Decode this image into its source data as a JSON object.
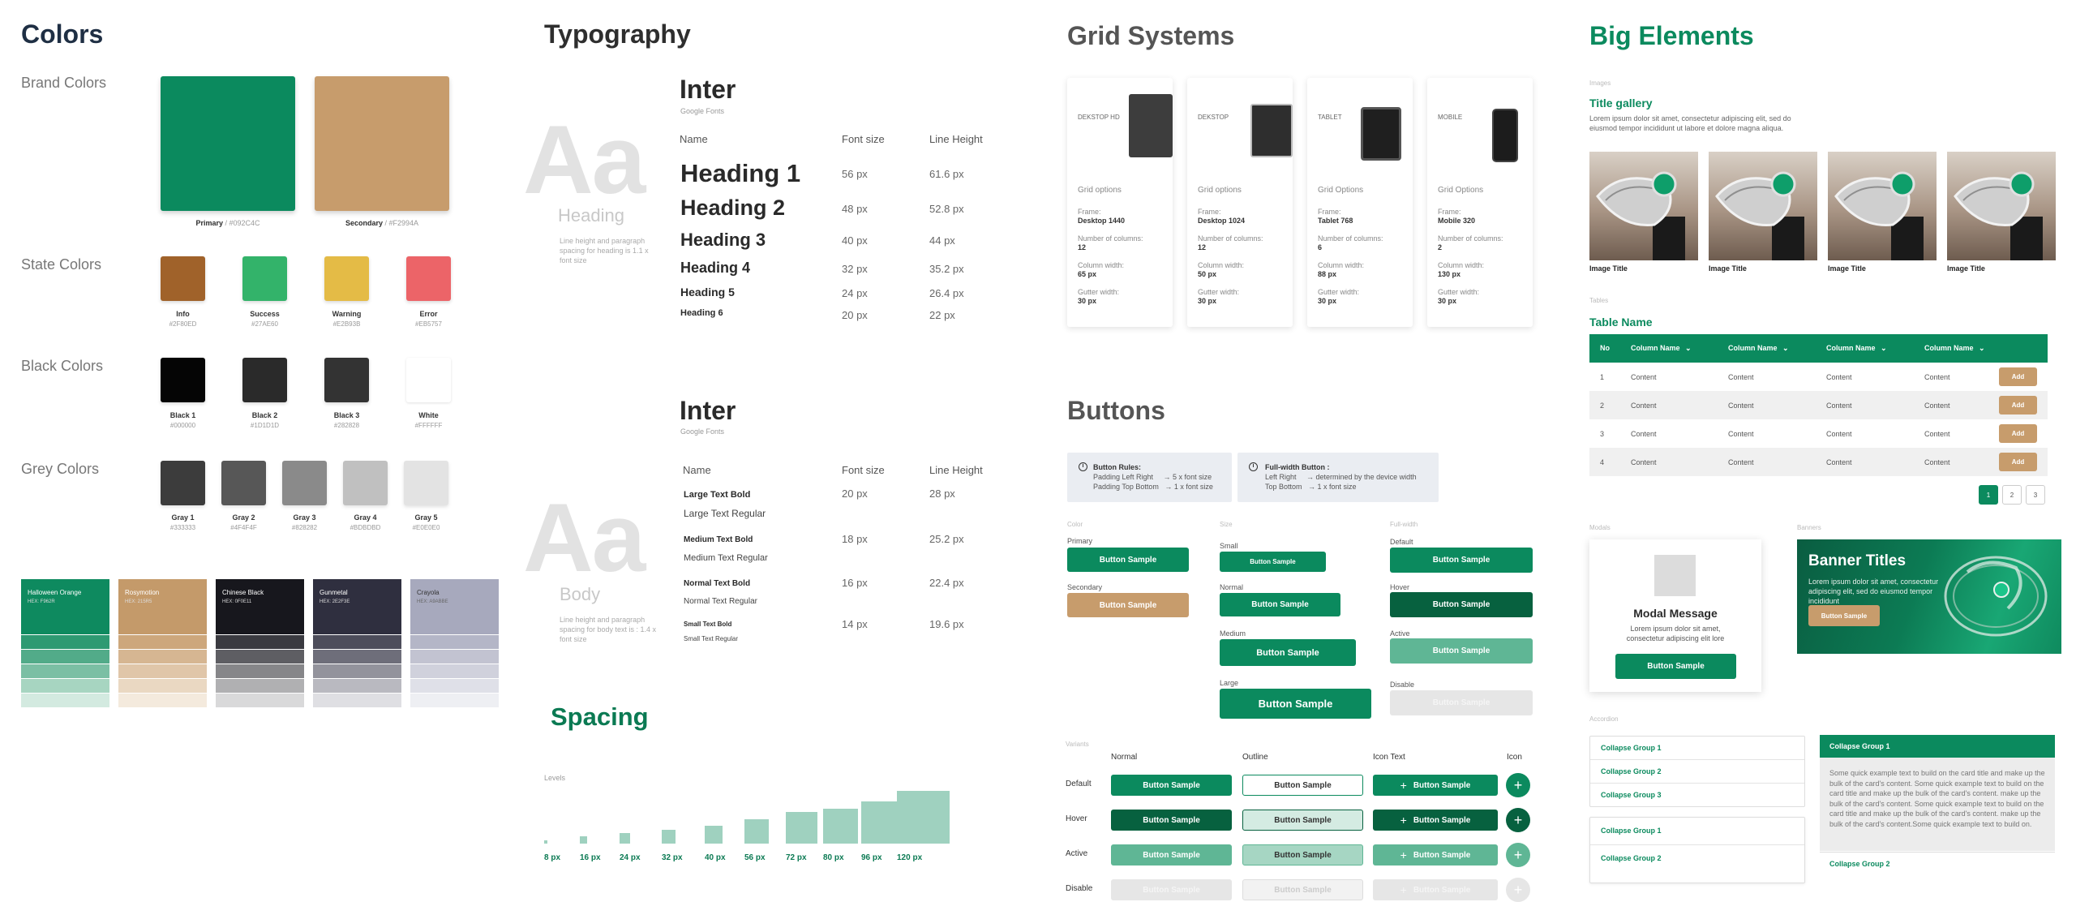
{
  "colors": {
    "title": "Colors",
    "brand_label": "Brand Colors",
    "state_label": "State Colors",
    "black_label": "Black Colors",
    "grey_label": "Grey Colors",
    "brand": [
      {
        "name": "Primary",
        "hex": "#0B8C5E",
        "caption": "#092C4C",
        "color": "#0b8a5e"
      },
      {
        "name": "Secondary",
        "hex": "#C8A06E",
        "caption": "#F2994A",
        "color": "#c79c6c"
      }
    ],
    "state": [
      {
        "name": "Info",
        "hex": "#2F80ED",
        "color": "#a0622a"
      },
      {
        "name": "Success",
        "hex": "#27AE60",
        "color": "#33b36a"
      },
      {
        "name": "Warning",
        "hex": "#E2B93B",
        "color": "#e4bb46"
      },
      {
        "name": "Error",
        "hex": "#EB5757",
        "color": "#ec6468"
      }
    ],
    "black": [
      {
        "name": "Black 1",
        "hex": "#000000",
        "color": "#050505"
      },
      {
        "name": "Black 2",
        "hex": "#1D1D1D",
        "color": "#2a2a2a"
      },
      {
        "name": "Black 3",
        "hex": "#282828",
        "color": "#333333"
      },
      {
        "name": "White",
        "hex": "#FFFFFF",
        "color": "#ffffff"
      }
    ],
    "grey": [
      {
        "name": "Gray 1",
        "hex": "#333333",
        "color": "#3c3c3c"
      },
      {
        "name": "Gray 2",
        "hex": "#4F4F4F",
        "color": "#575757"
      },
      {
        "name": "Gray 3",
        "hex": "#828282",
        "color": "#8a8a8a"
      },
      {
        "name": "Gray 4",
        "hex": "#BDBDBD",
        "color": "#c0c0c0"
      },
      {
        "name": "Gray 5",
        "hex": "#E0E0E0",
        "color": "#e3e3e3"
      }
    ],
    "palettes": [
      {
        "name": "Halloween Orange",
        "hex": "HEX: F962R",
        "base": "#0e8a5f",
        "shades": [
          "#2e9a72",
          "#52ab89",
          "#7bbfa4",
          "#a7d5c1",
          "#d3eae0"
        ]
      },
      {
        "name": "Rosymotion",
        "hex": "HEX: 215R5",
        "base": "#c49a6a",
        "shades": [
          "#cda77c",
          "#d6b692",
          "#e0c6a9",
          "#ead8c2",
          "#f4eadd"
        ]
      },
      {
        "name": "Chinese Black",
        "hex": "HEX: 0F0E11",
        "base": "#17171d",
        "shades": [
          "#3a3a40",
          "#5e5e63",
          "#868689",
          "#b0b0b2",
          "#d9d9da"
        ]
      },
      {
        "name": "Gunmetal",
        "hex": "HEX: 2E2F3E",
        "base": "#2f2f3f",
        "shades": [
          "#4d4d5b",
          "#6e6e7a",
          "#93939c",
          "#b9b9c0",
          "#dfdfe3"
        ]
      },
      {
        "name": "Crayola",
        "hex": "HEX: A9ABBE",
        "base": "#a7a9bd",
        "shades": [
          "#b4b6c7",
          "#c2c3d1",
          "#d0d1dc",
          "#dfe0e8",
          "#eeeff3"
        ]
      }
    ]
  },
  "typography": {
    "title": "Typography",
    "heading_block": {
      "font": "Inter",
      "source": "Google Fonts",
      "sample": "Aa",
      "kind": "Heading",
      "note": "Line height and paragraph spacing for heading is 1.1 x font size",
      "cols": [
        "Name",
        "Font size",
        "Line Height"
      ],
      "rows": [
        {
          "name": "Heading 1",
          "size": "56 px",
          "lh": "61.6 px"
        },
        {
          "name": "Heading 2",
          "size": "48 px",
          "lh": "52.8 px"
        },
        {
          "name": "Heading 3",
          "size": "40 px",
          "lh": "44 px"
        },
        {
          "name": "Heading 4",
          "size": "32 px",
          "lh": "35.2 px"
        },
        {
          "name": "Heading 5",
          "size": "24 px",
          "lh": "26.4 px"
        },
        {
          "name": "Heading 6",
          "size": "20 px",
          "lh": "22 px"
        }
      ]
    },
    "body_block": {
      "font": "Inter",
      "source": "Google Fonts",
      "sample": "Aa",
      "kind": "Body",
      "note": "Line height and paragraph spacing for body text is : 1.4 x font size",
      "cols": [
        "Name",
        "Font size",
        "Line Height"
      ],
      "rows": [
        {
          "bold": "Large Text Bold",
          "regular": "Large Text Regular",
          "size": "20 px",
          "lh": "28 px"
        },
        {
          "bold": "Medium Text Bold",
          "regular": "Medium Text Regular",
          "size": "18 px",
          "lh": "25.2 px"
        },
        {
          "bold": "Normal Text Bold",
          "regular": "Normal Text Regular",
          "size": "16 px",
          "lh": "22.4 px"
        },
        {
          "bold": "Small Text Bold",
          "regular": "Small Text Regular",
          "size": "14 px",
          "lh": "19.6 px"
        }
      ]
    }
  },
  "spacing": {
    "title": "Spacing",
    "levels_label": "Levels",
    "levels": [
      {
        "label": "8 px",
        "value": 8
      },
      {
        "label": "16 px",
        "value": 16
      },
      {
        "label": "24 px",
        "value": 24
      },
      {
        "label": "32 px",
        "value": 32
      },
      {
        "label": "40 px",
        "value": 40
      },
      {
        "label": "56 px",
        "value": 56
      },
      {
        "label": "72 px",
        "value": 72
      },
      {
        "label": "80 px",
        "value": 80
      },
      {
        "label": "96 px",
        "value": 96
      },
      {
        "label": "120 px",
        "value": 120
      }
    ]
  },
  "grid": {
    "title": "Grid Systems",
    "cards": [
      {
        "device": "DEKSTOP HD",
        "opt": "Grid options",
        "frame": "Desktop 1440",
        "cols": "12",
        "cw": "65 px",
        "gw": "30 px"
      },
      {
        "device": "DEKSTOP",
        "opt": "Grid options",
        "frame": "Desktop 1024",
        "cols": "12",
        "cw": "50 px",
        "gw": "30 px"
      },
      {
        "device": "TABLET",
        "opt": "Grid Options",
        "frame": "Tablet 768",
        "cols": "6",
        "cw": "88 px",
        "gw": "30 px"
      },
      {
        "device": "MOBILE",
        "opt": "Grid Options",
        "frame": "Mobile 320",
        "cols": "2",
        "cw": "130 px",
        "gw": "30 px"
      }
    ],
    "frame_label": "Frame:",
    "cols_label": "Number of columns:",
    "cw_label": "Column width:",
    "gw_label": "Gutter width:"
  },
  "buttons": {
    "title": "Buttons",
    "rules_title": "Button Rules:",
    "rules_1": "Padding Left Right     → 5 x font size",
    "rules_2": "Padding Top Bottom   → 1 x font size",
    "full_title": "Full-width Button :",
    "full_1": "Left Right     → determined by the device width",
    "full_2": "Top Bottom   → 1 x font size",
    "color_label": "Color",
    "primary_label": "Primary",
    "secondary_label": "Secondary",
    "size_label": "Size",
    "small_label": "Small",
    "normal_label": "Normal",
    "medium_label": "Medium",
    "large_label": "Large",
    "fw_label": "Full-width",
    "default_label": "Default",
    "hover_label": "Hover",
    "active_label": "Active",
    "disable_label": "Disable",
    "sample": "Button Sample",
    "variants_label": "Variants",
    "v_normal": "Normal",
    "v_outline": "Outline",
    "v_icontext": "Icon Text",
    "v_icon": "Icon",
    "row_default": "Default",
    "row_hover": "Hover",
    "row_active": "Active",
    "row_disable": "Disable",
    "plus": "+",
    "info_glyph": "i"
  },
  "big": {
    "title": "Big Elements",
    "images_label": "Images",
    "gallery_title": "Title gallery",
    "gallery_desc": "Lorem ipsum dolor sit amet, consectetur adipiscing elit, sed do eiusmod tempor incididunt ut labore et dolore magna aliqua.",
    "image_titles": [
      "Image Title",
      "Image Title",
      "Image Title",
      "Image Title"
    ],
    "tables_label": "Tables",
    "table_name": "Table Name",
    "table_cols": [
      "No",
      "Column Name",
      "Column Name",
      "Column Name",
      "Column Name"
    ],
    "table_rows": [
      {
        "no": "1",
        "c": [
          "Content",
          "Content",
          "Content",
          "Content"
        ],
        "btn": "Add"
      },
      {
        "no": "2",
        "c": [
          "Content",
          "Content",
          "Content",
          "Content"
        ],
        "btn": "Add"
      },
      {
        "no": "3",
        "c": [
          "Content",
          "Content",
          "Content",
          "Content"
        ],
        "btn": "Add"
      },
      {
        "no": "4",
        "c": [
          "Content",
          "Content",
          "Content",
          "Content"
        ],
        "btn": "Add"
      }
    ],
    "pages": [
      "1",
      "2",
      "3"
    ],
    "modals_label": "Modals",
    "modal_title": "Modal Message",
    "modal_desc": "Lorem ipsum dolor sit amet, consectetur adipiscing elit lore",
    "modal_btn": "Button Sample",
    "banners_label": "Banners",
    "banner_title": "Banner Titles",
    "banner_desc": "Lorem ipsum dolor sit amet, consectetur adipiscing elit, sed do eiusmod tempor incididunt",
    "banner_btn": "Button Sample",
    "accordion_label": "Accordion",
    "acc_left": [
      "Collapse Group 1",
      "Collapse Group 2",
      "Collapse Group 3"
    ],
    "acc_left2": [
      "Collapse Group 1",
      "Collapse Group 2"
    ],
    "acc_right_open": "Collapse Group 1",
    "acc_right_body": "Some quick example text to build on the card title and make up the bulk of the card's content. Some quick example text to build on the card title and make up the bulk of the card's content.  make up the bulk of the card's content. Some quick example text to build on the card title and make up the bulk of the card's content.  make up the bulk of the card's content.Some quick example text to build on.",
    "acc_right_2": "Collapse Group 2"
  },
  "accent": "#0b8a5e",
  "secondary": "#c79c6c"
}
